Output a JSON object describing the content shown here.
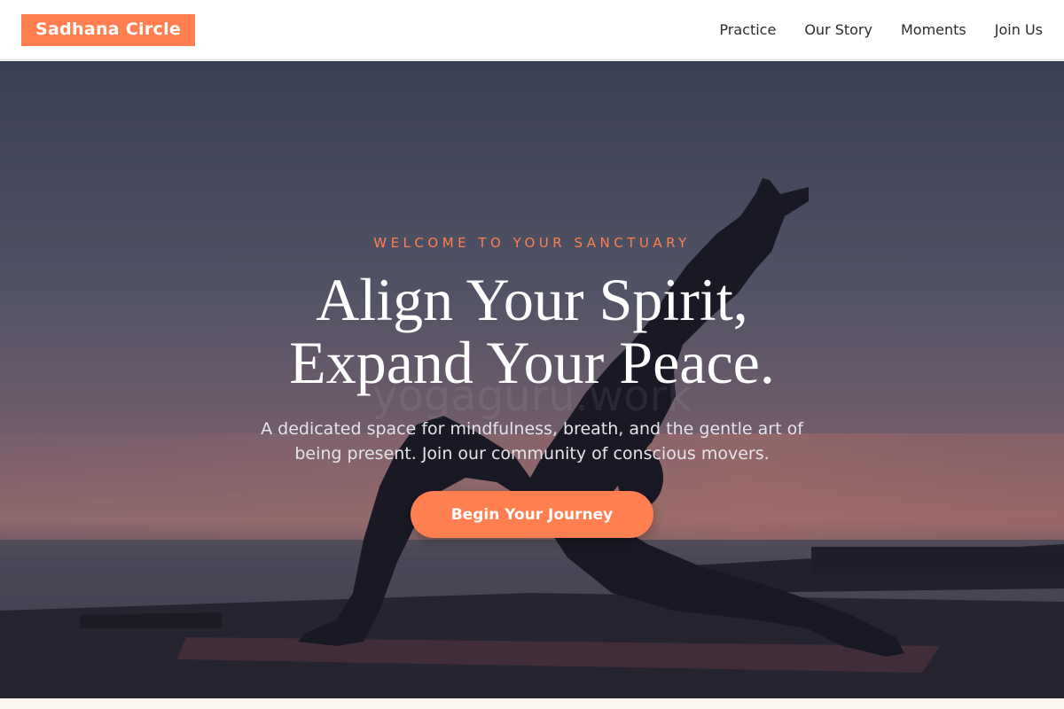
{
  "navbar": {
    "brand": "Sadhana Circle",
    "links": [
      "Practice",
      "Our Story",
      "Moments",
      "Join Us"
    ]
  },
  "hero": {
    "eyebrow": "WELCOME TO YOUR SANCTUARY",
    "headline_line1": "Align Your Spirit,",
    "headline_line2": "Expand Your Peace.",
    "subtext": "A dedicated space for mindfulness, breath, and the gentle art of being present. Join our community of conscious movers.",
    "cta_label": "Begin Your Journey",
    "watermark": "yogaguru.work",
    "photo_description_icon": "yoga-silhouette-image"
  },
  "colors": {
    "accent": "#ff7f50",
    "nav_bg": "#ffffff",
    "nav_text": "#2b2b2b",
    "hero_text": "#ffffff"
  }
}
